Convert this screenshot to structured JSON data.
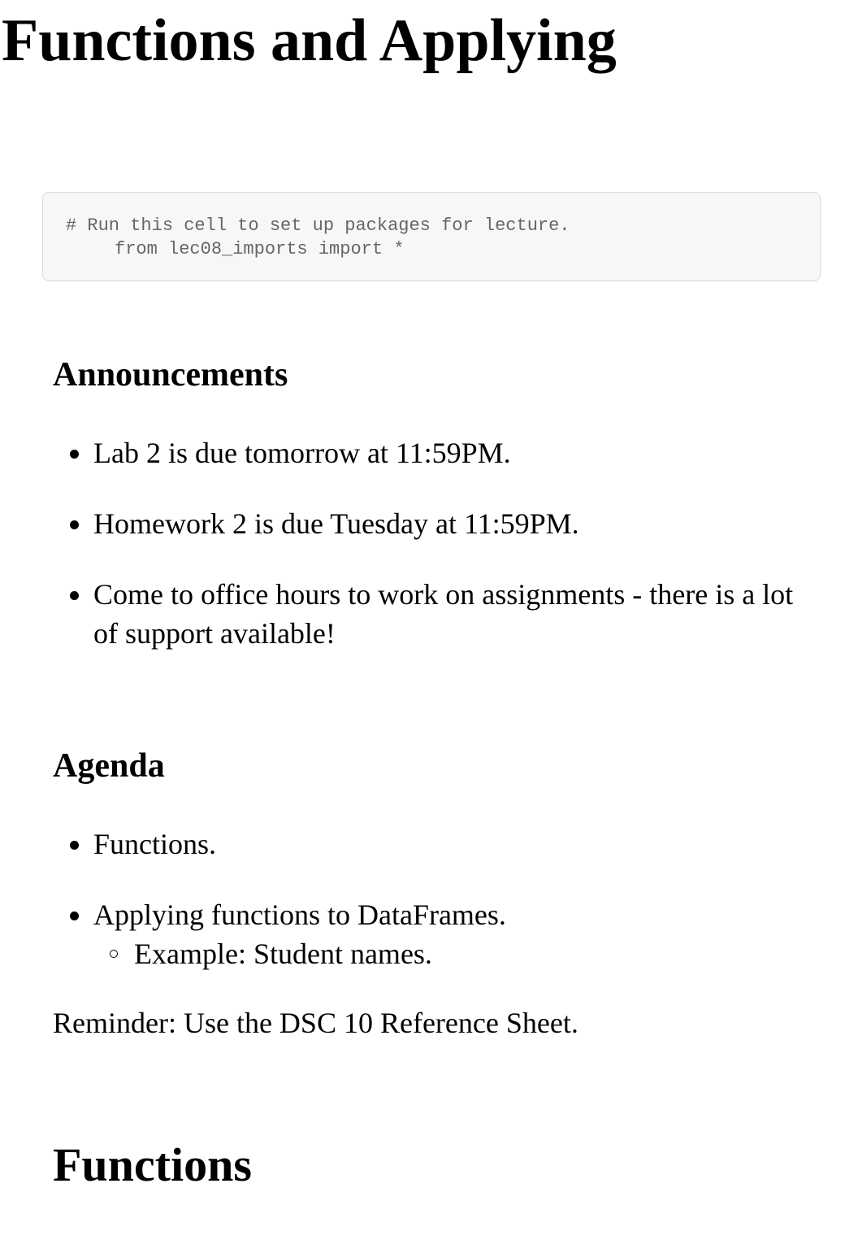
{
  "page": {
    "title": "Functions and Applying"
  },
  "code_cell": {
    "line1": "# Run this cell to set up packages for lecture.",
    "line2": "from lec08_imports import *"
  },
  "announcements": {
    "heading": "Announcements",
    "items": [
      "Lab 2 is due tomorrow at 11:59PM.",
      "Homework 2 is due Tuesday at 11:59PM.",
      "Come to office hours to work on assignments - there is a lot of support available!"
    ]
  },
  "agenda": {
    "heading": "Agenda",
    "items": [
      "Functions.",
      "Applying functions to DataFrames."
    ],
    "subitems": [
      "Example: Student names."
    ]
  },
  "reminder": "Reminder: Use the DSC 10 Reference Sheet.",
  "functions_section": {
    "heading": "Functions"
  }
}
